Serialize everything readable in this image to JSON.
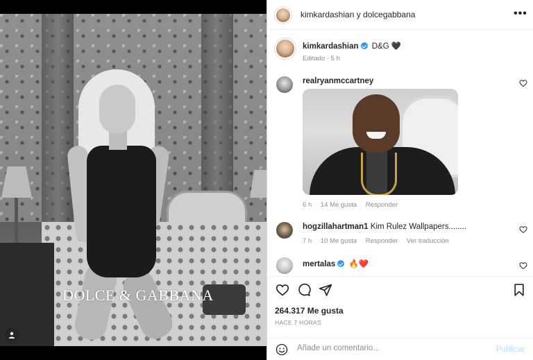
{
  "post": {
    "brand_text": "DOLCE & GABBANA"
  },
  "header": {
    "title": "kimkardashian y dolcegabbana",
    "more_icon": "more-horizontal-icon"
  },
  "caption": {
    "username": "kimkardashian",
    "text": "D&G",
    "emoji": "🖤",
    "meta": "Editado · 5 h"
  },
  "comments": [
    {
      "username": "realryanmccartney",
      "text": "",
      "has_gif": true,
      "time": "6 h",
      "likes": "14 Me gusta",
      "reply": "Responder"
    },
    {
      "username": "hogzillahartman1",
      "text": "Kim Rulez Wallpapers........",
      "time": "7 h",
      "likes": "10 Me gusta",
      "reply": "Responder",
      "translate": "Ver traducción"
    },
    {
      "username": "mertalas",
      "text": "🔥❤️"
    }
  ],
  "actions": {
    "like_icon": "heart-icon",
    "comment_icon": "comment-icon",
    "share_icon": "send-icon",
    "save_icon": "bookmark-icon"
  },
  "stats": {
    "likes": "264.317 Me gusta",
    "time_ago": "HACE 7 HORAS"
  },
  "comment_box": {
    "placeholder": "Añade un comentario...",
    "post_label": "Publicar",
    "emoji_icon": "smiley-icon"
  }
}
